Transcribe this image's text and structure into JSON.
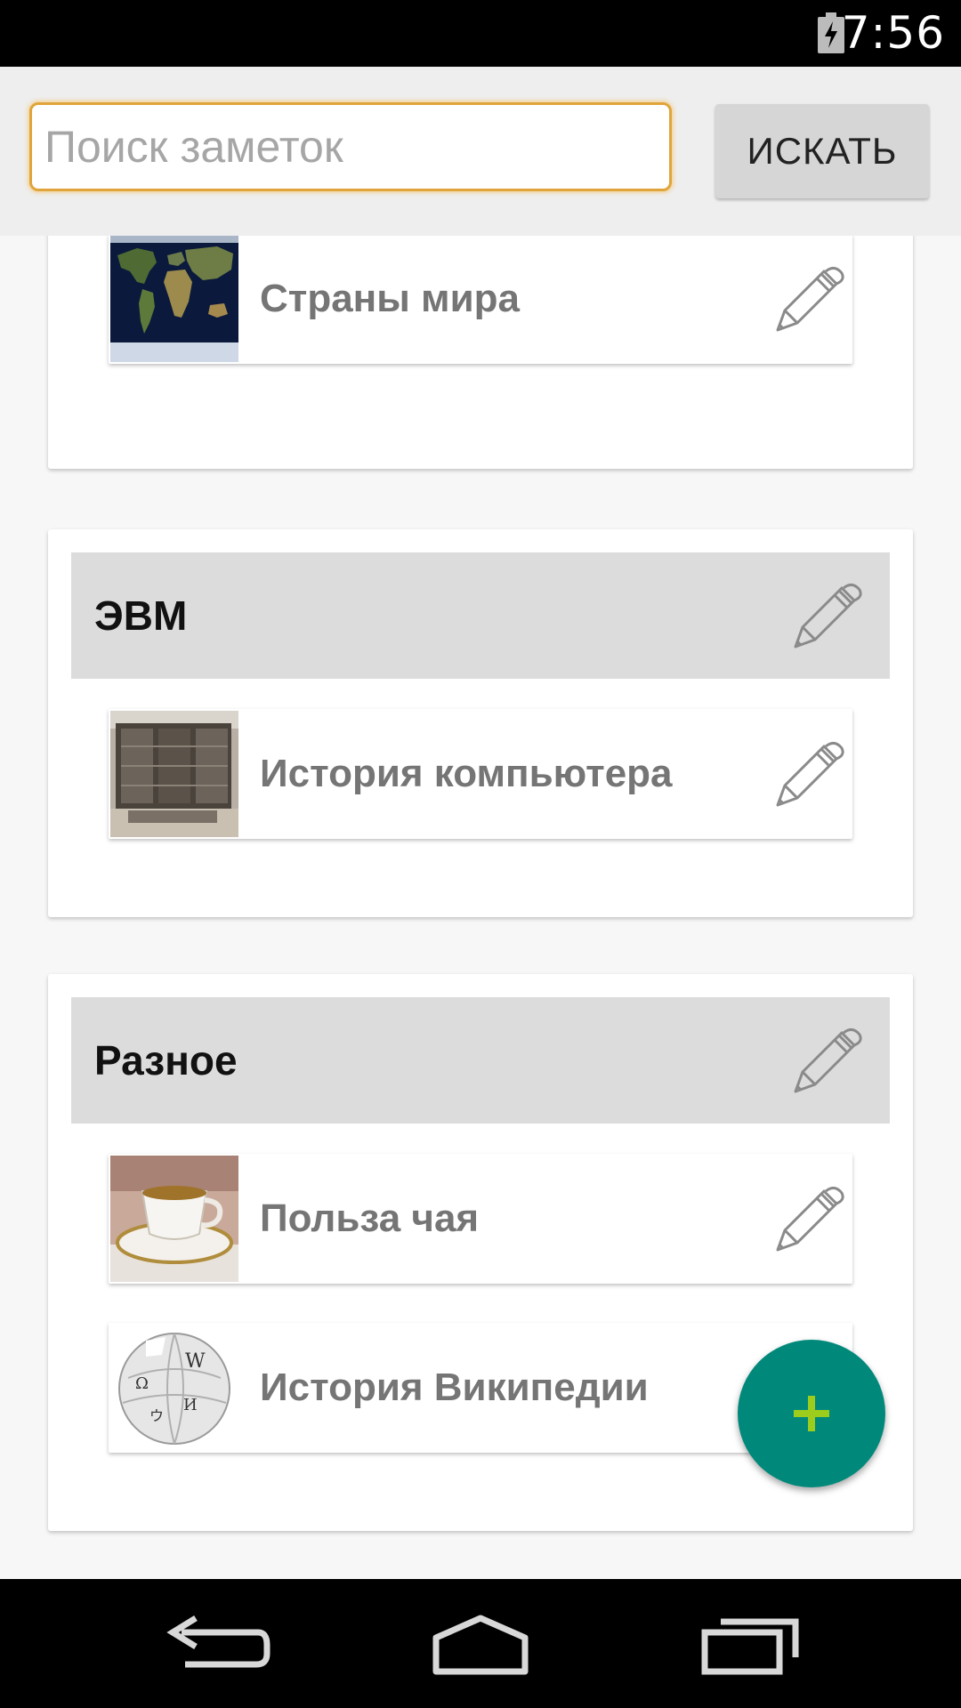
{
  "status_bar": {
    "time": "7:56",
    "battery_icon": "battery-charging-icon"
  },
  "search": {
    "placeholder": "Поиск заметок",
    "value": "",
    "button_label": "ИСКАТЬ"
  },
  "categories": [
    {
      "title": "",
      "notes": [
        {
          "title": "Страны мира",
          "thumb": "world-map-thumb"
        }
      ]
    },
    {
      "title": "ЭВМ",
      "notes": [
        {
          "title": "История компьютера",
          "thumb": "computer-thumb"
        }
      ]
    },
    {
      "title": "Разное",
      "notes": [
        {
          "title": "Польза чая",
          "thumb": "tea-cup-thumb"
        },
        {
          "title": "История Википедии",
          "thumb": "wikipedia-globe-thumb"
        }
      ]
    }
  ],
  "fab": {
    "icon": "plus-icon"
  },
  "nav_bar": {
    "back": "back-icon",
    "home": "home-icon",
    "recents": "recents-icon"
  },
  "colors": {
    "accent": "#00897b",
    "plus": "#9ccc1c",
    "search_border": "#e0a53a"
  }
}
